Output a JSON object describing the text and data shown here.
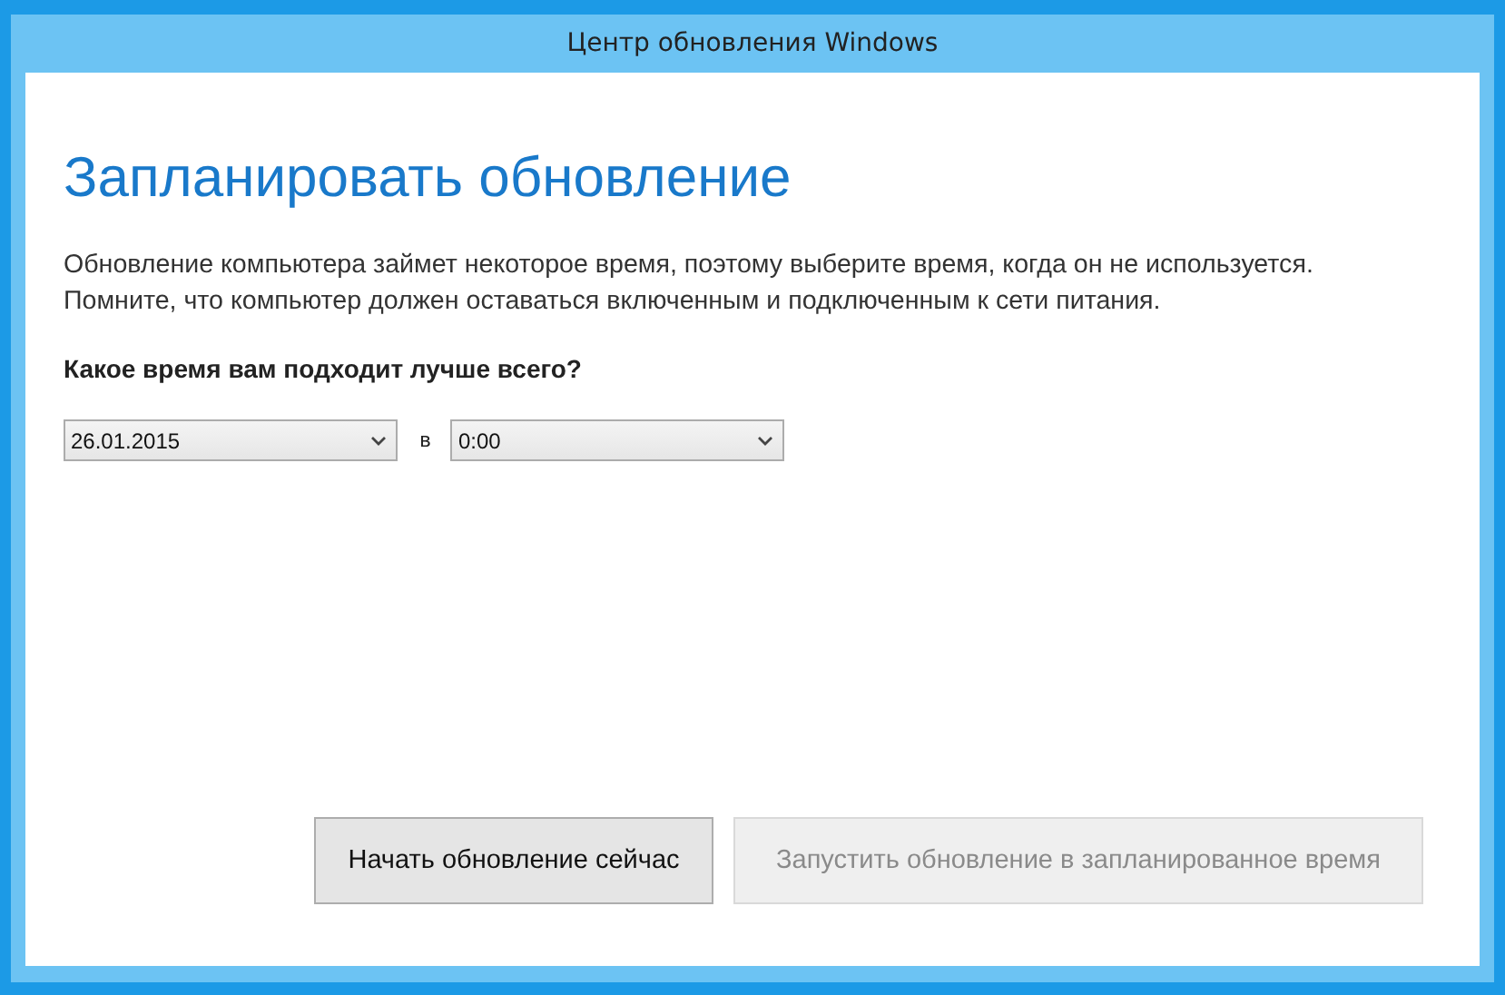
{
  "window": {
    "title": "Центр обновления Windows"
  },
  "heading": "Запланировать обновление",
  "description_lines": [
    "Обновление компьютера займет некоторое время, поэтому выберите время, когда он не используется.",
    "Помните, что компьютер должен оставаться включенным и подключенным к сети питания."
  ],
  "question": "Какое время вам подходит лучше всего?",
  "date_select": {
    "value": "26.01.2015"
  },
  "separator": "в",
  "time_select": {
    "value": "0:00"
  },
  "buttons": [
    {
      "label": "Начать обновление сейчас",
      "disabled": false
    },
    {
      "label": "Запустить обновление в запланированное время",
      "disabled": true
    }
  ]
}
